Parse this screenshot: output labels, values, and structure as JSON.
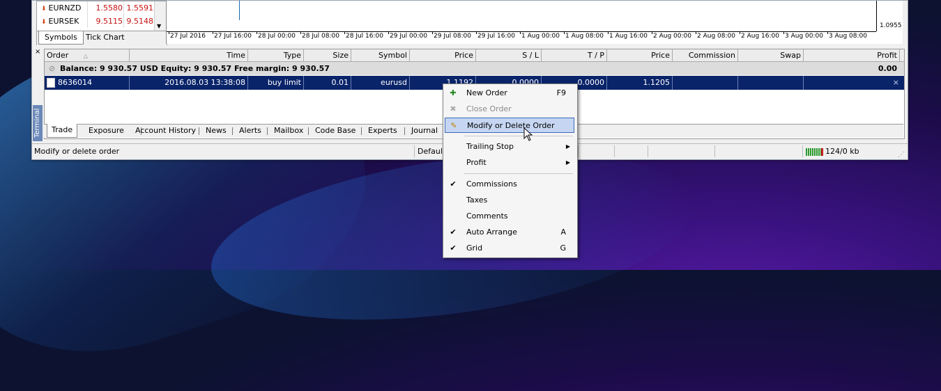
{
  "market_watch": {
    "rows": [
      {
        "symbol": "EURNZD",
        "bid": "1.5580",
        "ask": "1.5591"
      },
      {
        "symbol": "EURSEK",
        "bid": "9.5115",
        "ask": "9.5148"
      }
    ],
    "tabs": [
      "Symbols",
      "Tick Chart"
    ]
  },
  "chart": {
    "price_label": "1.0955",
    "time_labels": [
      "27 Jul 2016",
      "27 Jul 16:00",
      "28 Jul 00:00",
      "28 Jul 08:00",
      "28 Jul 16:00",
      "29 Jul 00:00",
      "29 Jul 08:00",
      "29 Jul 16:00",
      "1 Aug 00:00",
      "1 Aug 08:00",
      "1 Aug 16:00",
      "2 Aug 00:00",
      "2 Aug 08:00",
      "2 Aug 16:00",
      "3 Aug 00:00",
      "3 Aug 08:00"
    ]
  },
  "terminal": {
    "side_label": "Terminal",
    "close": "×",
    "columns": [
      "Order",
      "Time",
      "Type",
      "Size",
      "Symbol",
      "Price",
      "S / L",
      "T / P",
      "Price",
      "Commission",
      "Swap",
      "Profit"
    ],
    "balance_text": "Balance: 9 930.57 USD  Equity: 9 930.57  Free margin: 9 930.57",
    "balance_profit": "0.00",
    "order": {
      "id": "8636014",
      "time": "2016.08.03 13:38:08",
      "type": "buy limit",
      "size": "0.01",
      "symbol": "eurusd",
      "price": "1.1192",
      "sl": "0.0000",
      "tp": "0.0000",
      "cur_price": "1.1205",
      "close": "×"
    },
    "tabs": [
      "Trade",
      "Exposure",
      "Account History",
      "News",
      "Alerts",
      "Mailbox",
      "Code Base",
      "Experts",
      "Journal"
    ]
  },
  "statusbar": {
    "hint": "Modify or delete order",
    "profile": "Default",
    "traffic": "124/0 kb"
  },
  "context_menu": {
    "items": [
      {
        "label": "New Order",
        "shortcut": "F9"
      },
      {
        "label": "Close Order",
        "shortcut": ""
      },
      {
        "label": "Modify or Delete Order",
        "shortcut": ""
      },
      {
        "label": "Trailing Stop",
        "shortcut": ""
      },
      {
        "label": "Profit",
        "shortcut": ""
      },
      {
        "label": "Commissions",
        "shortcut": ""
      },
      {
        "label": "Taxes",
        "shortcut": ""
      },
      {
        "label": "Comments",
        "shortcut": ""
      },
      {
        "label": "Auto Arrange",
        "shortcut": "A"
      },
      {
        "label": "Grid",
        "shortcut": "G"
      }
    ]
  },
  "colors": {
    "selection": "#0a246a",
    "menu_highlight": "#c6d6f2",
    "price_red": "#c81010"
  }
}
